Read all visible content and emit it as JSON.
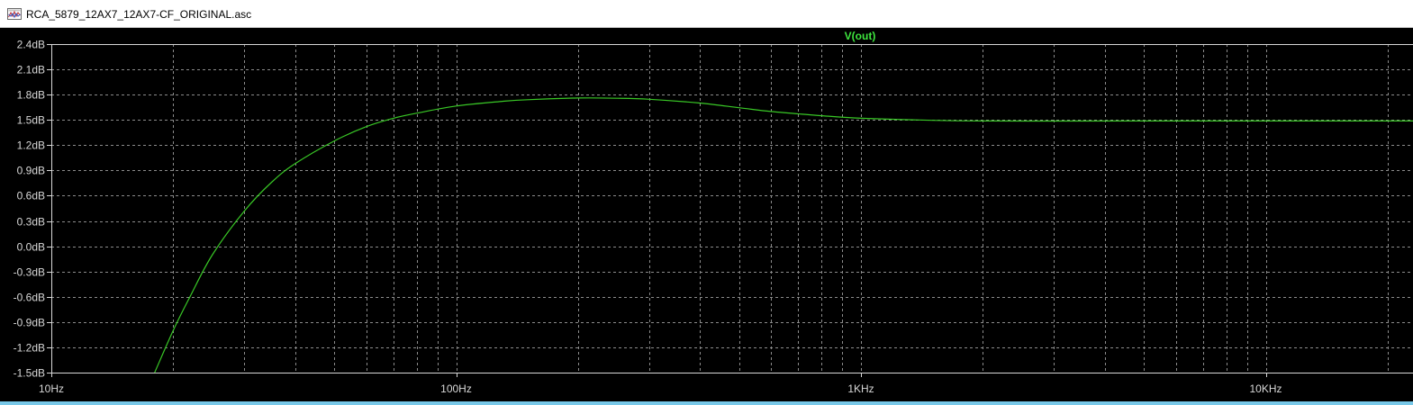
{
  "window": {
    "title": "RCA_5879_12AX7_12AX7-CF_ORIGINAL.asc",
    "icon": "waveform-viewer-icon"
  },
  "colors": {
    "background": "#000000",
    "grid": "#8c8c8c",
    "trace": "#39c826",
    "trace_label": "#3ee63e",
    "axis_text": "#d8d8d8"
  },
  "chart_data": {
    "type": "line",
    "title": "V(out)",
    "x_scale": "log",
    "x_unit": "Hz",
    "xlim": [
      10,
      25000
    ],
    "ylim": [
      -1.5,
      2.4
    ],
    "grid": true,
    "y_ticks": [
      {
        "value": 2.4,
        "label": "2.4dB"
      },
      {
        "value": 2.1,
        "label": "2.1dB"
      },
      {
        "value": 1.8,
        "label": "1.8dB"
      },
      {
        "value": 1.5,
        "label": "1.5dB"
      },
      {
        "value": 1.2,
        "label": "1.2dB"
      },
      {
        "value": 0.9,
        "label": "0.9dB"
      },
      {
        "value": 0.6,
        "label": "0.6dB"
      },
      {
        "value": 0.3,
        "label": "0.3dB"
      },
      {
        "value": 0.0,
        "label": "0.0dB"
      },
      {
        "value": -0.3,
        "label": "-0.3dB"
      },
      {
        "value": -0.6,
        "label": "-0.6dB"
      },
      {
        "value": -0.9,
        "label": "-0.9dB"
      },
      {
        "value": -1.2,
        "label": "-1.2dB"
      },
      {
        "value": -1.5,
        "label": "-1.5dB"
      }
    ],
    "x_ticks": [
      {
        "value": 10,
        "label": "10Hz"
      },
      {
        "value": 100,
        "label": "100Hz"
      },
      {
        "value": 1000,
        "label": "1KHz"
      },
      {
        "value": 10000,
        "label": "10KHz"
      }
    ],
    "series": [
      {
        "name": "V(out)",
        "x": [
          18,
          20,
          22,
          25,
          30,
          35,
          40,
          50,
          60,
          70,
          80,
          100,
          130,
          150,
          200,
          250,
          300,
          400,
          500,
          600,
          800,
          1000,
          1500,
          2000,
          3000,
          5000,
          10000,
          25000
        ],
        "y": [
          -1.5,
          -1.0,
          -0.6,
          -0.1,
          0.42,
          0.76,
          0.98,
          1.25,
          1.42,
          1.52,
          1.58,
          1.665,
          1.72,
          1.74,
          1.76,
          1.757,
          1.745,
          1.7,
          1.645,
          1.6,
          1.55,
          1.52,
          1.495,
          1.487,
          1.486,
          1.487,
          1.487,
          1.487
        ]
      }
    ]
  }
}
